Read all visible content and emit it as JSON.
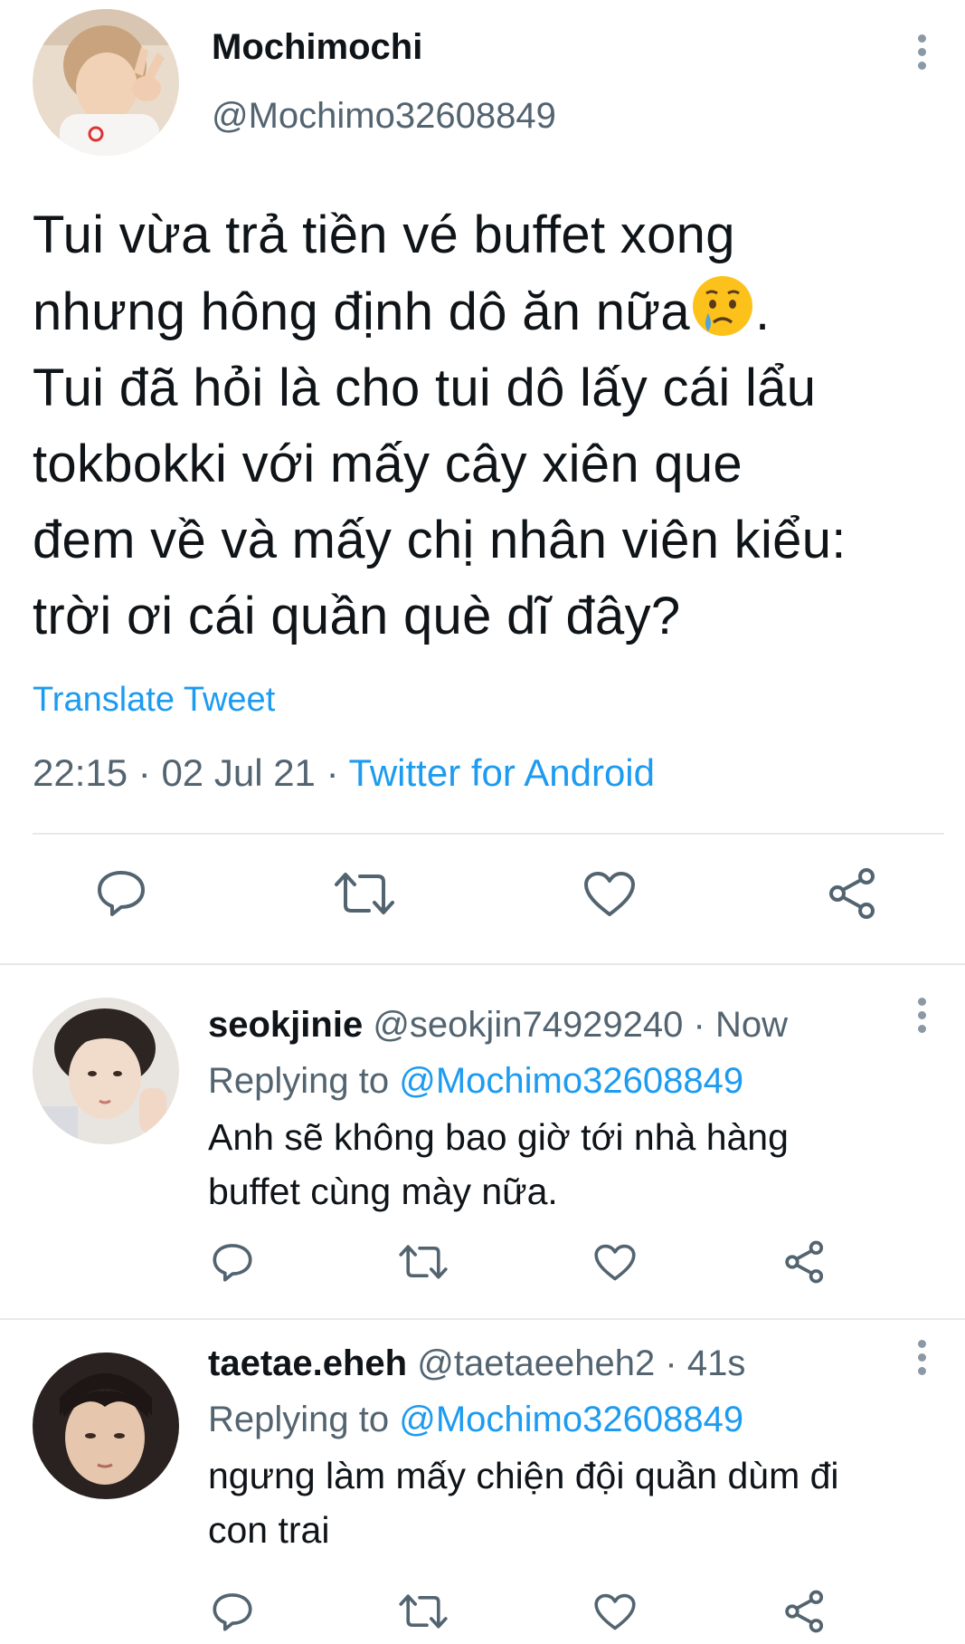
{
  "main_tweet": {
    "display_name": "Mochimochi",
    "handle": "@Mochimo32608849",
    "avatar": "user-avatar-photo",
    "text_lines": [
      "Tui vừa trả tiền vé buffet xong",
      "nhưng hông định dô ăn nữa",
      "Tui đã hỏi là cho tui dô lấy cái lẩu",
      "tokbokki với mấy cây xiên que",
      "đem về và mấy chị nhân viên kiểu:",
      "trời ơi cái quần què dĩ đây?"
    ],
    "line2_suffix": ".",
    "emoji": "crying-face-emoji",
    "translate_label": "Translate Tweet",
    "time": "22:15",
    "separator": "·",
    "date": "02 Jul 21",
    "source": "Twitter for Android",
    "actions": [
      "reply-icon",
      "retweet-icon",
      "like-icon",
      "share-icon"
    ]
  },
  "replies": [
    {
      "display_name": "seokjinie",
      "handle": "@seokjin74929240",
      "separator": "·",
      "time": "Now",
      "replying_prefix": "Replying to",
      "replying_to": "@Mochimo32608849",
      "text_lines": [
        "Anh sẽ không bao giờ tới nhà hàng",
        "buffet cùng mày nữa."
      ]
    },
    {
      "display_name": "taetae.eheh",
      "handle": "@taetaeeheh2",
      "separator": "·",
      "time": "41s",
      "replying_prefix": "Replying to",
      "replying_to": "@Mochimo32608849",
      "text_lines": [
        "ngưng làm mấy chiện đội quần dùm đi",
        "con trai"
      ]
    }
  ],
  "colors": {
    "text": "#0f1419",
    "secondary": "#536471",
    "accent": "#1d9bf0",
    "divider": "#e6e9ec",
    "icon": "#536471"
  }
}
